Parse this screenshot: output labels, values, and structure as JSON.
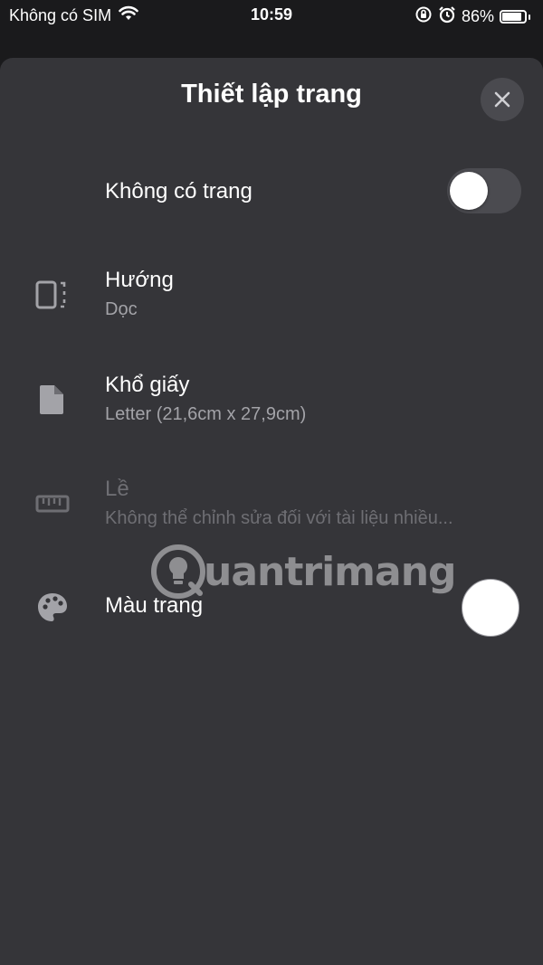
{
  "status_bar": {
    "carrier": "Không có SIM",
    "time": "10:59",
    "battery_percent": "86%",
    "battery_level": 0.86,
    "icons": [
      "wifi-icon",
      "orientation-lock-icon",
      "alarm-icon",
      "battery-icon"
    ]
  },
  "sheet": {
    "title": "Thiết lập trang"
  },
  "no_page": {
    "label": "Không có trang",
    "toggle_on": false
  },
  "orientation": {
    "label": "Hướng",
    "value": "Dọc",
    "icon": "orientation-icon"
  },
  "paper_size": {
    "label": "Khổ giấy",
    "value": "Letter (21,6cm x 27,9cm)",
    "icon": "document-icon"
  },
  "margins": {
    "label": "Lề",
    "value": "Không thể chỉnh sửa đối với tài liệu nhiều...",
    "icon": "ruler-icon",
    "disabled": true
  },
  "page_color": {
    "label": "Màu trang",
    "icon": "palette-icon",
    "swatch_color": "#ffffff"
  },
  "watermark": {
    "text": "uantrimang"
  }
}
